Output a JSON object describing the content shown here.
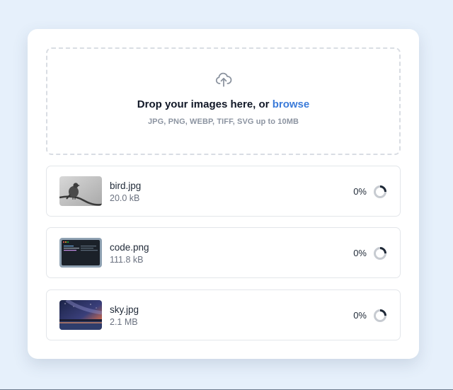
{
  "dropzone": {
    "title_prefix": "Drop your images here, or ",
    "browse_label": "browse",
    "hint": "JPG, PNG, WEBP, TIFF, SVG up to 10MB",
    "upload_icon": "cloud-upload-icon"
  },
  "files": [
    {
      "name": "bird.jpg",
      "size": "20.0 kB",
      "progress_label": "0%",
      "progress": 0
    },
    {
      "name": "code.png",
      "size": "111.8 kB",
      "progress_label": "0%",
      "progress": 0
    },
    {
      "name": "sky.jpg",
      "size": "2.1 MB",
      "progress_label": "0%",
      "progress": 0
    }
  ],
  "colors": {
    "background": "#e6f0fb",
    "card": "#ffffff",
    "accent": "#3b7bd9",
    "border": "#e3e6ea"
  }
}
